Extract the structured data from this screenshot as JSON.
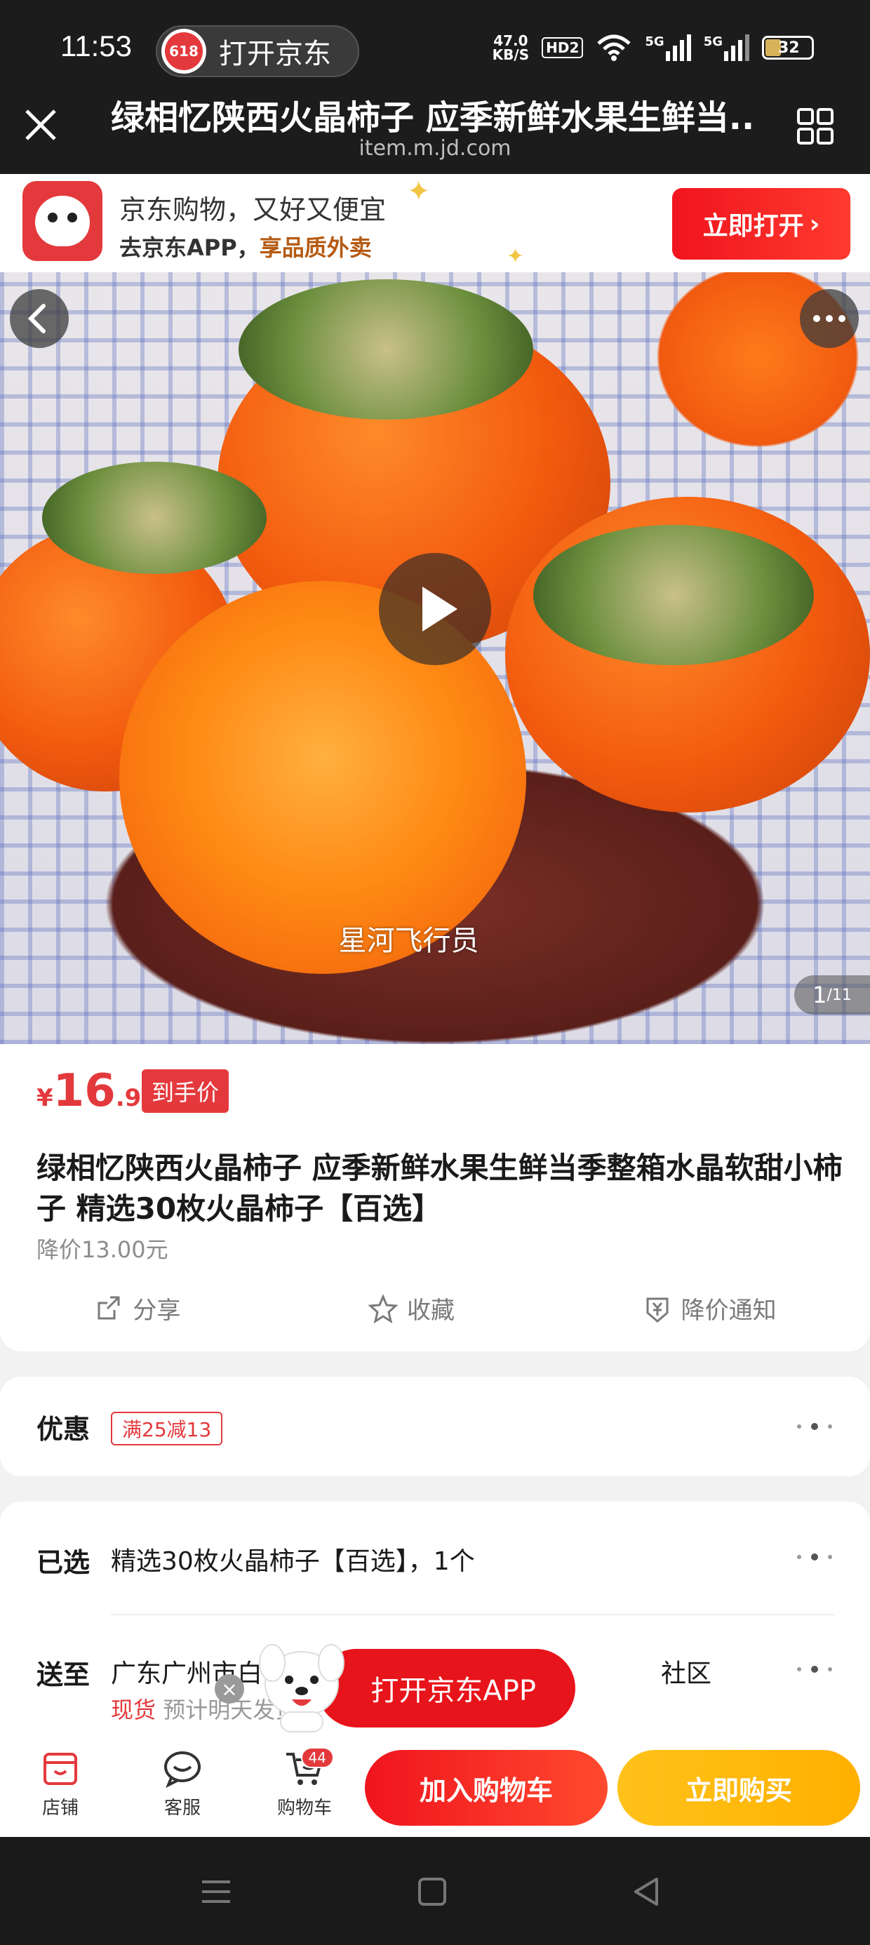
{
  "status_bar": {
    "time": "11:53",
    "open_app_pill": "打开京东",
    "pill_logo": "618",
    "net_speed_value": "47.0",
    "net_speed_unit": "KB/S",
    "hd_badge": "HD2",
    "sim1": "5G",
    "sim2": "5G",
    "battery": "32"
  },
  "browser": {
    "title": "绿相忆陕西火晶柿子 应季新鲜水果生鲜当...",
    "url": "item.m.jd.com"
  },
  "app_banner": {
    "line1": "京东购物，又好又便宜",
    "line2_prefix": "去京东APP，",
    "line2_highlight": "享品质外卖",
    "open_button": "立即打开"
  },
  "hero": {
    "watermark": "星河飞行员",
    "counter_current": "1",
    "counter_total": "/11"
  },
  "product": {
    "currency": "¥",
    "price_int": "16",
    "price_dec": ".90",
    "price_tag": "到手价",
    "title": "绿相忆陕西火晶柿子 应季新鲜水果生鲜当季整箱水晶软甜小柿子 精选30枚火晶柿子【百选】",
    "price_drop": "降价13.00元",
    "actions": [
      "分享",
      "收藏",
      "降价通知"
    ]
  },
  "promo": {
    "label": "优惠",
    "coupon": "满25减13"
  },
  "selection": {
    "label": "已选",
    "value": "精选30枚火晶柿子【百选】，1个",
    "ship_label": "送至",
    "ship_address_start": "广东广州市白",
    "ship_address_end": "社区",
    "stock_status": "现货",
    "stock_note": "预计明天发货"
  },
  "floating_ad": {
    "label": "打开京东APP",
    "close": "×"
  },
  "bottom_bar": {
    "shop": "店铺",
    "service": "客服",
    "cart": "购物车",
    "cart_count": "44",
    "add_to_cart": "加入购物车",
    "buy_now": "立即购买"
  },
  "colors": {
    "brand_red": "#e4393c",
    "buy_yellow": "#ffb000",
    "dark_bar": "#1c1c1c"
  }
}
